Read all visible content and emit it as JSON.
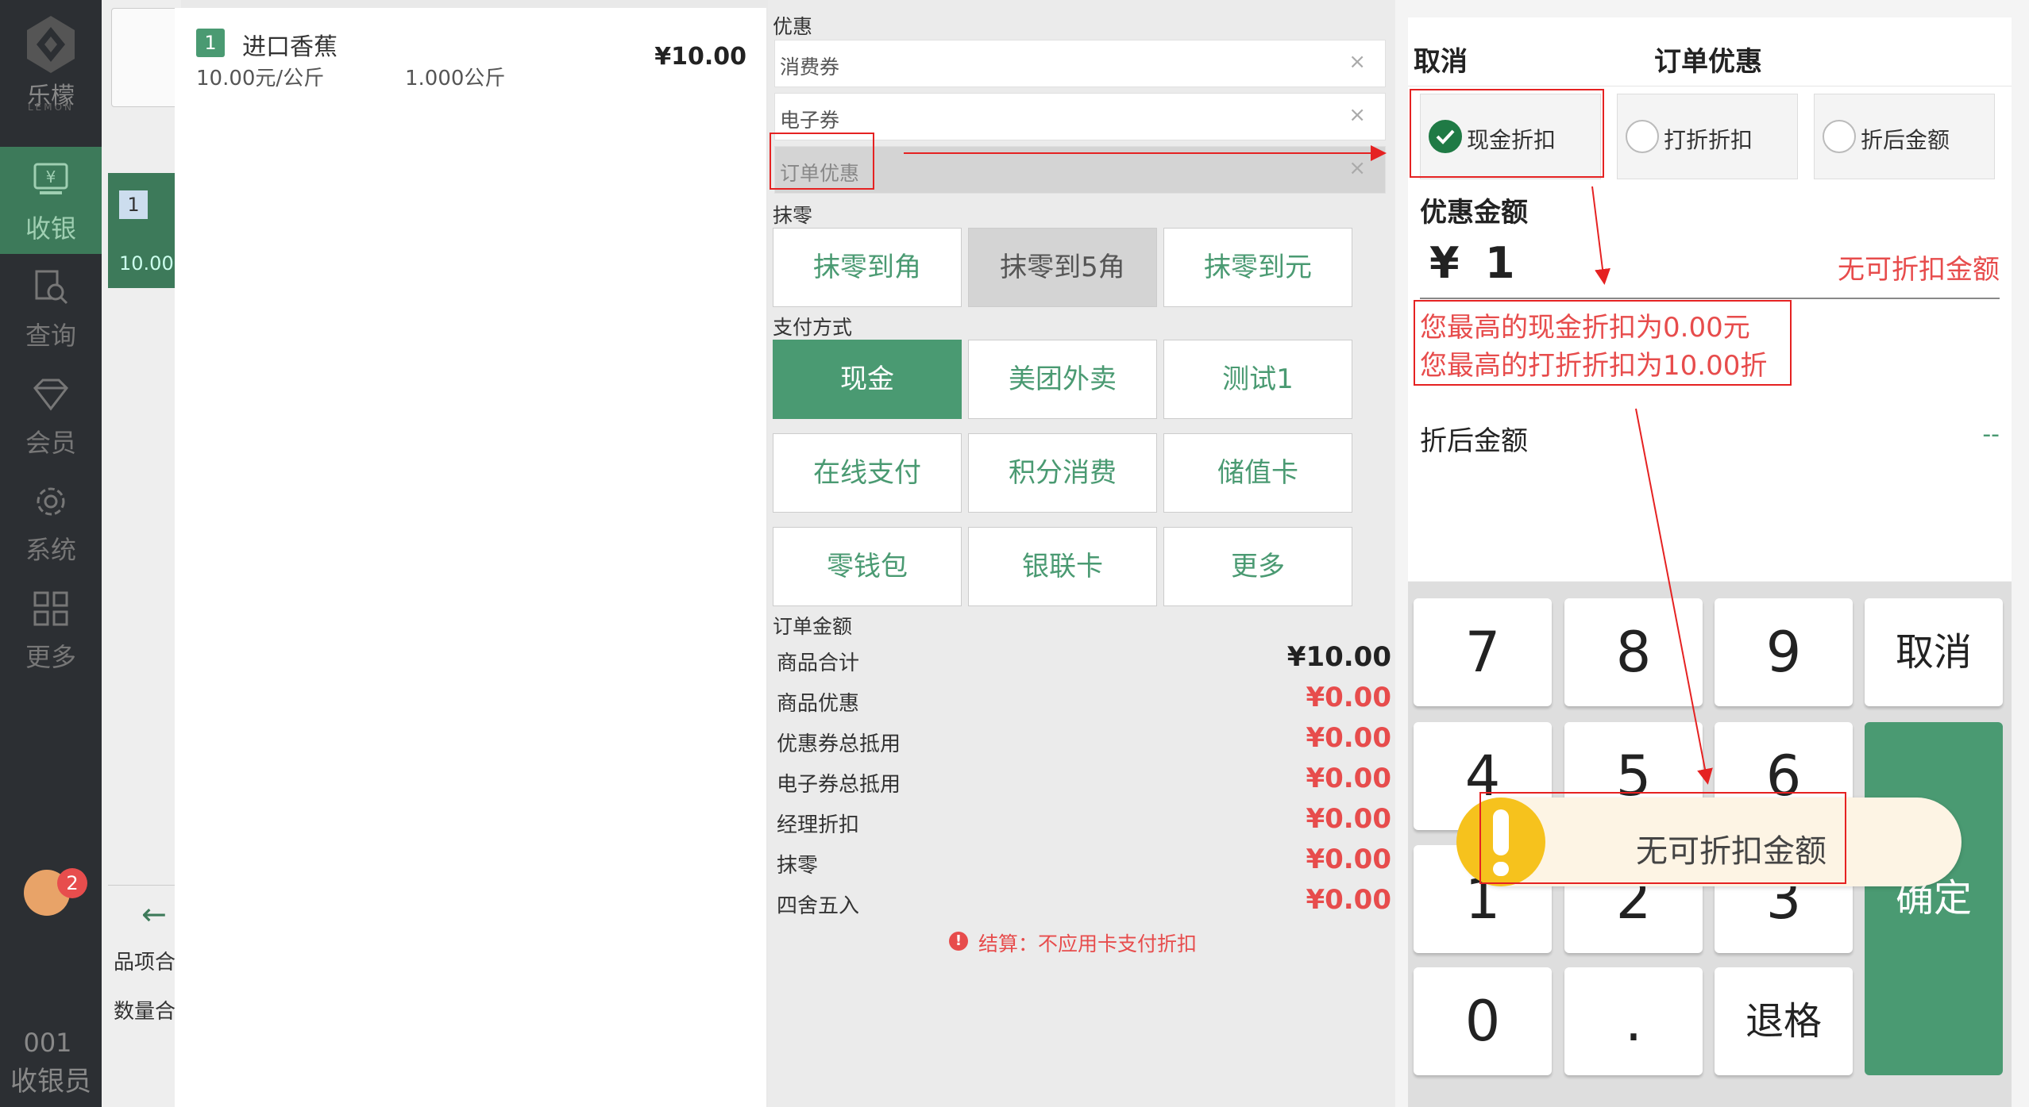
{
  "sidebar": {
    "brand": "乐檬",
    "brand_sub": "LEMON",
    "nav": [
      {
        "label": "收银",
        "icon": "cashier-icon",
        "active": true
      },
      {
        "label": "查询",
        "icon": "search-doc-icon",
        "active": false
      },
      {
        "label": "会员",
        "icon": "diamond-icon",
        "active": false
      },
      {
        "label": "系统",
        "icon": "gear-icon",
        "active": false
      },
      {
        "label": "更多",
        "icon": "grid-icon",
        "active": false
      }
    ],
    "notification_count": "2",
    "cashier_no": "001",
    "cashier_label": "收银员"
  },
  "background_panel": {
    "item_num": "1",
    "price": "10.00",
    "items_label": "品项合",
    "qty_label": "数量合"
  },
  "order": {
    "items": [
      {
        "num": "1",
        "name": "进口香蕉",
        "unit_price": "10.00元/公斤",
        "weight": "1.000公斤",
        "total": "¥10.00"
      }
    ]
  },
  "settlement": {
    "discount_section": "优惠",
    "coupons": [
      {
        "label": "消费券",
        "close": "×",
        "disabled": false
      },
      {
        "label": "电子券",
        "close": "×",
        "disabled": false
      },
      {
        "label": "订单优惠",
        "close": "×",
        "disabled": true
      }
    ],
    "rounding_section": "抹零",
    "rounding_options": [
      "抹零到角",
      "抹零到5角",
      "抹零到元"
    ],
    "payment_section": "支付方式",
    "payment_methods": [
      "现金",
      "美团外卖",
      "测试1",
      "在线支付",
      "积分消费",
      "储值卡",
      "零钱包",
      "银联卡",
      "更多"
    ],
    "amount_section": "订单金额",
    "amounts": [
      {
        "label": "商品合计",
        "value": "¥10.00"
      },
      {
        "label": "商品优惠",
        "value": "¥0.00"
      },
      {
        "label": "优惠券总抵用",
        "value": "¥0.00"
      },
      {
        "label": "电子券总抵用",
        "value": "¥0.00"
      },
      {
        "label": "经理折扣",
        "value": "¥0.00"
      },
      {
        "label": "抹零",
        "value": "¥0.00"
      },
      {
        "label": "四舍五入",
        "value": "¥0.00"
      }
    ],
    "note": "结算：不应用卡支付折扣",
    "note_icon": "!"
  },
  "dialog": {
    "cancel": "取消",
    "title": "订单优惠",
    "types": [
      {
        "label": "现金折扣",
        "checked": true
      },
      {
        "label": "打折折扣",
        "checked": false
      },
      {
        "label": "折后金额",
        "checked": false
      }
    ],
    "amount_label": "优惠金额",
    "currency": "¥",
    "amount_value": "1",
    "no_discount": "无可折扣金额",
    "max_cash": "您最高的现金折扣为0.00元",
    "max_rate": "您最高的打折折扣为10.00折",
    "after_label": "折后金额",
    "after_value": "--",
    "keys": [
      "7",
      "8",
      "9",
      "取消",
      "4",
      "5",
      "6",
      "1",
      "2",
      "3",
      "0",
      ".",
      "退格"
    ],
    "confirm": "确定"
  },
  "toast": {
    "text": "无可折扣金额",
    "icon": "warning-icon"
  },
  "colors": {
    "sidebar": "#2c2f33",
    "accent_green": "#4a9a72",
    "active_nav": "#3d7a5a",
    "error_red": "#e74c4c",
    "annotation_red": "#e52222",
    "toast_yellow": "#f6c21d"
  }
}
